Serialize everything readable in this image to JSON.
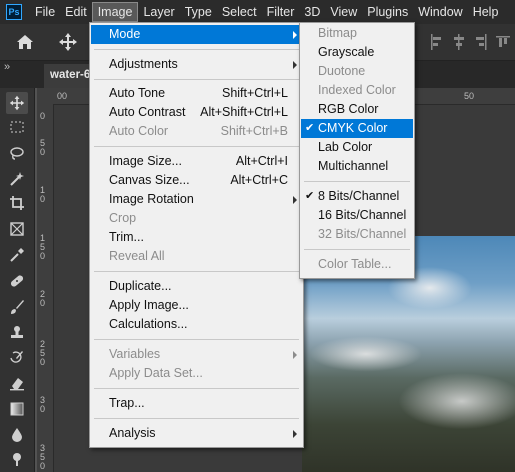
{
  "menubar": {
    "logo": "Ps",
    "items": [
      "File",
      "Edit",
      "Image",
      "Layer",
      "Type",
      "Select",
      "Filter",
      "3D",
      "View",
      "Plugins",
      "Window",
      "Help"
    ],
    "active": "Image"
  },
  "document": {
    "tab_label": "water-6"
  },
  "panel_toggle": "»",
  "rulers": {
    "top": [
      "00",
      "50"
    ],
    "left": [
      "0",
      "5",
      "0",
      "1",
      "0",
      "1",
      "5",
      "0",
      "2",
      "0",
      "2",
      "5",
      "0",
      "3",
      "0",
      "3",
      "5",
      "0"
    ]
  },
  "image_menu": {
    "items": [
      {
        "label": "Mode",
        "submenu": true,
        "highlighted": true
      },
      {
        "label": "Adjustments",
        "submenu": true
      },
      {
        "label": "Auto Tone",
        "shortcut": "Shift+Ctrl+L"
      },
      {
        "label": "Auto Contrast",
        "shortcut": "Alt+Shift+Ctrl+L"
      },
      {
        "label": "Auto Color",
        "shortcut": "Shift+Ctrl+B",
        "disabled": true
      },
      {
        "label": "Image Size...",
        "shortcut": "Alt+Ctrl+I"
      },
      {
        "label": "Canvas Size...",
        "shortcut": "Alt+Ctrl+C"
      },
      {
        "label": "Image Rotation",
        "submenu": true
      },
      {
        "label": "Crop",
        "disabled": true
      },
      {
        "label": "Trim..."
      },
      {
        "label": "Reveal All",
        "disabled": true
      },
      {
        "label": "Duplicate..."
      },
      {
        "label": "Apply Image..."
      },
      {
        "label": "Calculations..."
      },
      {
        "label": "Variables",
        "submenu": true,
        "disabled": true
      },
      {
        "label": "Apply Data Set...",
        "disabled": true
      },
      {
        "label": "Trap..."
      },
      {
        "label": "Analysis",
        "submenu": true
      }
    ]
  },
  "mode_menu": {
    "items": [
      {
        "label": "Bitmap",
        "disabled": true
      },
      {
        "label": "Grayscale"
      },
      {
        "label": "Duotone",
        "disabled": true
      },
      {
        "label": "Indexed Color",
        "disabled": true
      },
      {
        "label": "RGB Color"
      },
      {
        "label": "CMYK Color",
        "checked": true,
        "highlighted": true
      },
      {
        "label": "Lab Color"
      },
      {
        "label": "Multichannel"
      },
      {
        "label": "8 Bits/Channel",
        "checked": true
      },
      {
        "label": "16 Bits/Channel"
      },
      {
        "label": "32 Bits/Channel",
        "disabled": true
      },
      {
        "label": "Color Table...",
        "disabled": true
      }
    ],
    "check_glyph": "✔"
  },
  "colors": {
    "highlight": "#0078d7",
    "menu_bg": "#f0f0f0",
    "chrome": "#2b2b2b"
  }
}
